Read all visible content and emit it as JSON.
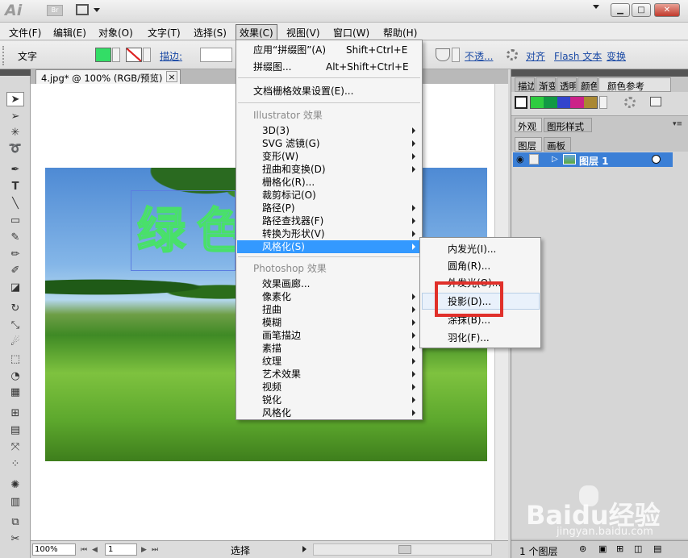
{
  "app": {
    "logo": "Ai",
    "bridge": "Br"
  },
  "menubar": [
    {
      "label": "文件(F)"
    },
    {
      "label": "编辑(E)"
    },
    {
      "label": "对象(O)"
    },
    {
      "label": "文字(T)"
    },
    {
      "label": "选择(S)"
    },
    {
      "label": "效果(C)"
    },
    {
      "label": "视图(V)"
    },
    {
      "label": "窗口(W)"
    },
    {
      "label": "帮助(H)"
    }
  ],
  "control_bar": {
    "mode_label": "文字",
    "fill_color": "#33dd66",
    "stroke_label": "描边:",
    "opacity_label": "不透...",
    "align_label": "对齐",
    "flash_label": "Flash 文本",
    "transform_label": "变换"
  },
  "document": {
    "tab_label": "4.jpg* @ 100% (RGB/预览)",
    "close": "×",
    "text_overlay": "绿色"
  },
  "status": {
    "zoom": "100%",
    "page": "1",
    "tool": "选择"
  },
  "effect_menu": {
    "apply_last": "应用“拼缀图”(A)",
    "apply_last_shortcut": "Shift+Ctrl+E",
    "last_effect": "拼缀图...",
    "last_effect_shortcut": "Alt+Shift+Ctrl+E",
    "raster_settings": "文档栅格效果设置(E)...",
    "illustrator_header": "Illustrator 效果",
    "illustrator_items": [
      "3D(3)",
      "SVG 滤镜(G)",
      "变形(W)",
      "扭曲和变换(D)",
      "栅格化(R)...",
      "裁剪标记(O)",
      "路径(P)",
      "路径查找器(F)",
      "转换为形状(V)",
      "风格化(S)"
    ],
    "photoshop_header": "Photoshop 效果",
    "photoshop_items": [
      "效果画廊...",
      "像素化",
      "扭曲",
      "模糊",
      "画笔描边",
      "素描",
      "纹理",
      "艺术效果",
      "视频",
      "锐化",
      "风格化"
    ]
  },
  "stylize_submenu": {
    "items": [
      "内发光(I)...",
      "圆角(R)...",
      "外发光(O)...",
      "投影(D)...",
      "涂抹(B)...",
      "羽化(F)..."
    ],
    "highlight_color": "#e0302a"
  },
  "right_panel": {
    "tabs_top": [
      "描边",
      "渐变",
      "透明",
      "颜色",
      "颜色参考"
    ],
    "swatches": [
      "#2ecc40",
      "#119944",
      "#3344cc",
      "#cc2288",
      "#aa8833"
    ],
    "tabs_mid": [
      "外观",
      "图形样式"
    ],
    "tabs_layers": [
      "图层",
      "画板"
    ],
    "layer_name": "图层 1",
    "layer_count": "1 个图层"
  },
  "watermark": {
    "brand": "Baidu经验",
    "url": "jingyan.baidu.com"
  }
}
